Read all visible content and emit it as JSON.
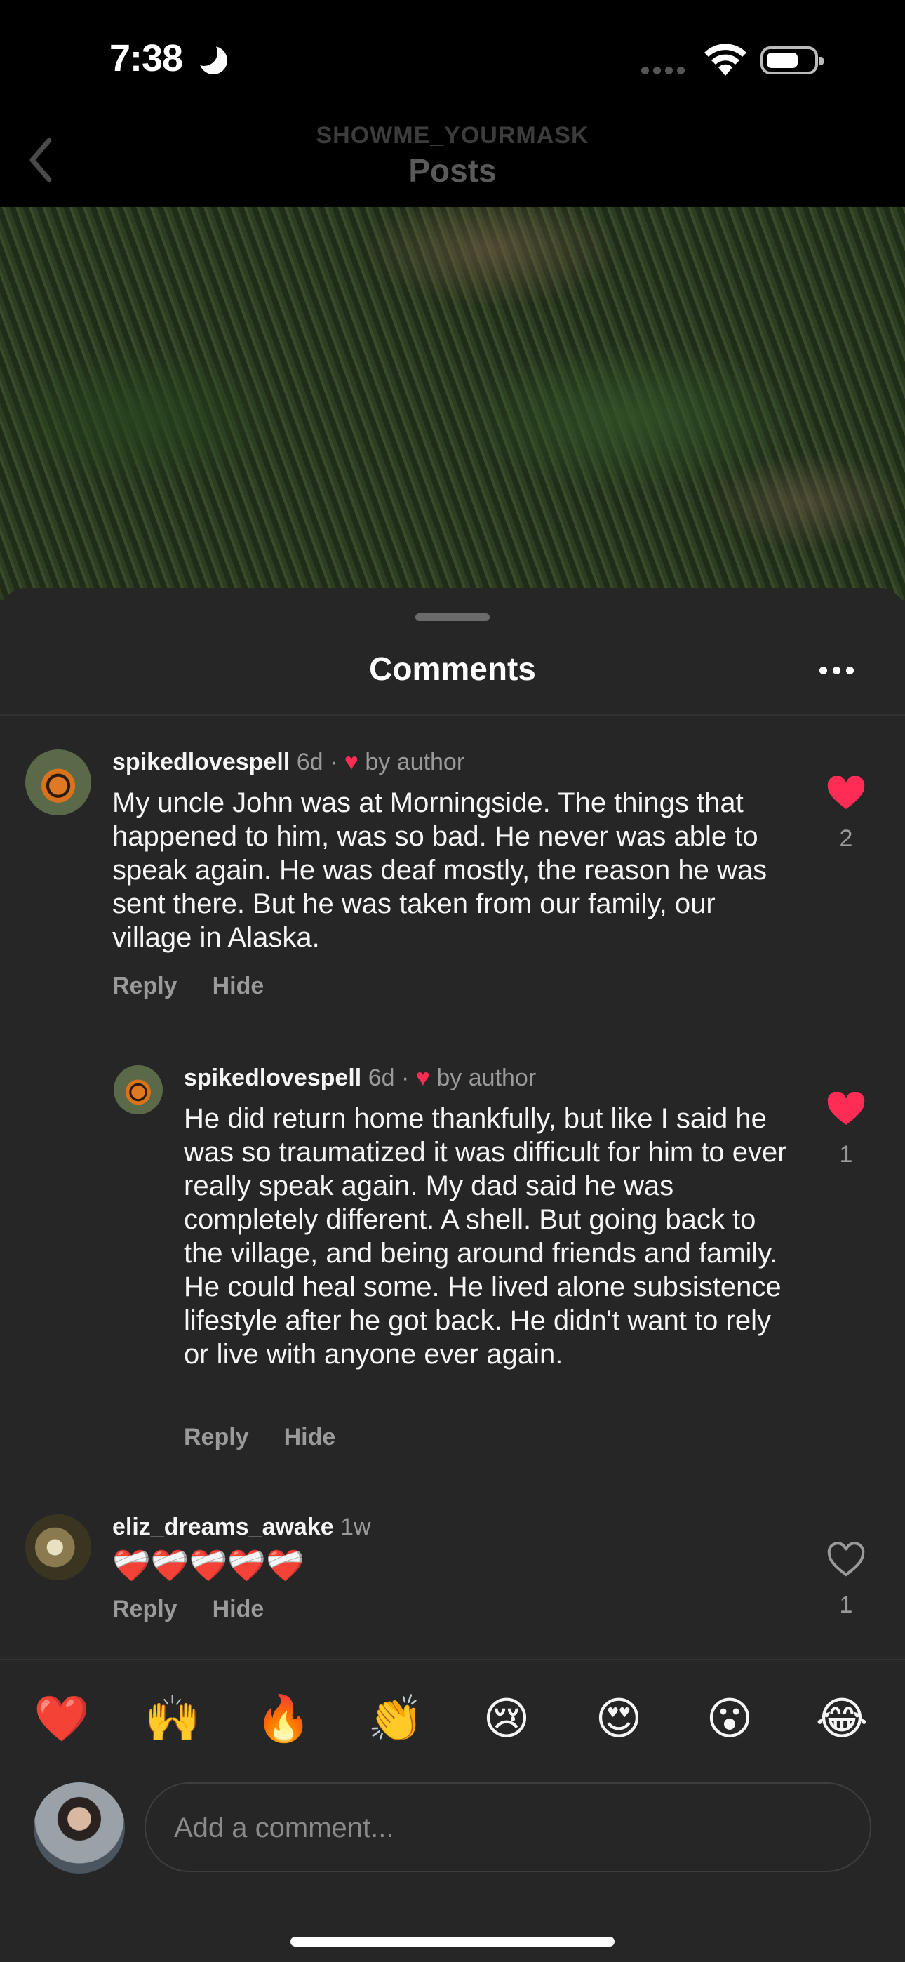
{
  "status_bar": {
    "time": "7:38"
  },
  "nav": {
    "subtitle": "SHOWME_YOURMASK",
    "title": "Posts"
  },
  "sheet": {
    "title": "Comments"
  },
  "comments": [
    {
      "username": "spikedlovespell",
      "age": "6d",
      "separator": "·",
      "liked_by_author": "by author",
      "text": "My uncle John was at Morningside.  The things that happened to him, was so bad. He never was able to speak again. He was deaf mostly, the reason he was sent there. But he was taken from our family, our village in Alaska.",
      "like_count": "2",
      "reply_label": "Reply",
      "hide_label": "Hide"
    },
    {
      "username": "spikedlovespell",
      "age": "6d",
      "separator": "·",
      "liked_by_author": "by author",
      "text": "He did return home thankfully,  but like I said he was so traumatized it was difficult for him to ever really speak again. My dad said he was completely different.  A shell. But going back to the village, and being around friends and family. He could heal some. He lived alone subsistence lifestyle after he got back. He didn't want to rely or live with anyone ever again.",
      "like_count": "1",
      "reply_label": "Reply",
      "hide_label": "Hide"
    },
    {
      "username": "eliz_dreams_awake",
      "age": "1w",
      "text": "❤️‍🩹❤️‍🩹❤️‍🩹❤️‍🩹❤️‍🩹",
      "like_count": "1",
      "reply_label": "Reply",
      "hide_label": "Hide"
    }
  ],
  "quick_reactions": [
    "❤️",
    "🙌",
    "🔥",
    "👏",
    "😢",
    "😍",
    "😮",
    "😂"
  ],
  "composer": {
    "placeholder": "Add a comment..."
  },
  "colors": {
    "like_red": "#ff2d55",
    "sheet_bg": "#262626",
    "muted": "#9a9a9a"
  }
}
